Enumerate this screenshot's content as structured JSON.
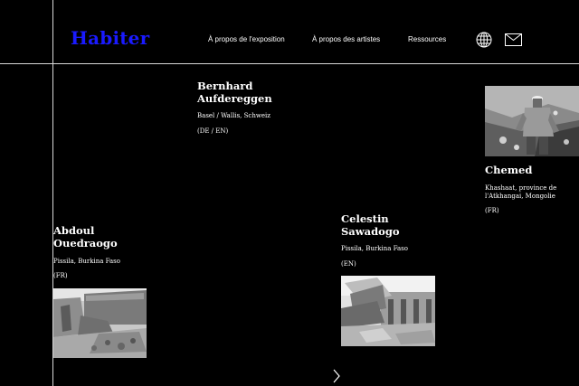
{
  "header": {
    "logo": "Habiter",
    "nav": [
      {
        "label": "À propos de l'exposition"
      },
      {
        "label": "À propos des artistes"
      },
      {
        "label": "Ressources"
      }
    ],
    "icons": [
      "globe-icon",
      "mail-icon"
    ]
  },
  "artists": [
    {
      "name_line1": "Bernhard",
      "name_line2": "Aufdereggen",
      "location": "Basel / Wallis, Schweiz",
      "languages": "(DE / EN)"
    },
    {
      "name_line1": "Chemed",
      "location_line1": "Khashaat, province de",
      "location_line2": "l'Atkhangai, Mongolie",
      "languages": "(FR)"
    },
    {
      "name_line1": "Abdoul",
      "name_line2": "Ouedraogo",
      "location": "Pissila, Burkina Faso",
      "languages": "(FR)"
    },
    {
      "name_line1": "Celestin",
      "name_line2": "Sawadogo",
      "location": "Pissila, Burkina Faso",
      "languages": "(EN)"
    }
  ],
  "colors": {
    "background": "#000000",
    "text": "#ffffff",
    "logo": "#1a1aff",
    "rules": "#d9d9d9"
  },
  "pager": {
    "next_icon": "chevron-right-icon"
  }
}
